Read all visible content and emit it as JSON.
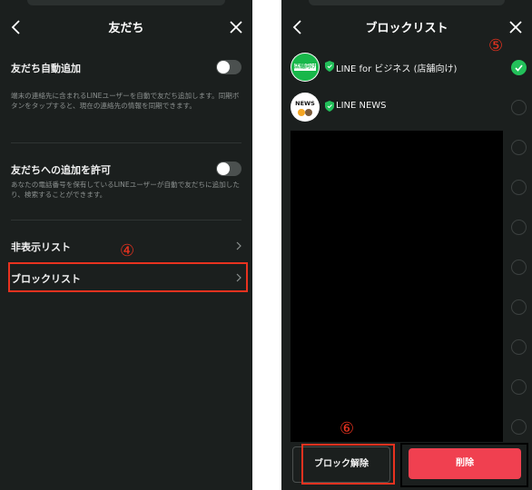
{
  "left_screen": {
    "title": "友だち",
    "auto_add": {
      "label": "友だち自動追加",
      "description": "端末の連絡先に含まれるLINEユーザーを自動で友だち追加します。同期ボタンをタップすると、現在の連絡先の情報を同期できます。",
      "enabled": false
    },
    "allow_add": {
      "label": "友だちへの追加を許可",
      "description": "あなたの電話番号を保有しているLINEユーザーが自動で友だちに追加したり、検索することができます。",
      "enabled": false
    },
    "rows": [
      {
        "label": "非表示リスト"
      },
      {
        "label": "ブロックリスト"
      }
    ],
    "step_marker": "④"
  },
  "right_screen": {
    "title": "ブロックリスト",
    "accounts": [
      {
        "name": "LINE for ビジネス (店舗向け)",
        "avatar_text": "店舗向け",
        "selected": true
      },
      {
        "name": "LINE NEWS",
        "avatar_text": "NEWS",
        "selected": false
      }
    ],
    "extra_checkbox_count": 8,
    "step_marker_select": "⑤",
    "step_marker_button": "⑥",
    "unblock_label": "ブロック解除",
    "delete_label": "削除"
  },
  "colors": {
    "background": "#1b1f1e",
    "accent_green": "#23c05a",
    "delete_red": "#f04050",
    "annotation_red": "#e8321f"
  },
  "icons": {
    "back": "chevron-left-icon",
    "close": "close-icon",
    "row_arrow": "chevron-right-icon",
    "verified": "shield-icon",
    "check": "check-icon"
  }
}
